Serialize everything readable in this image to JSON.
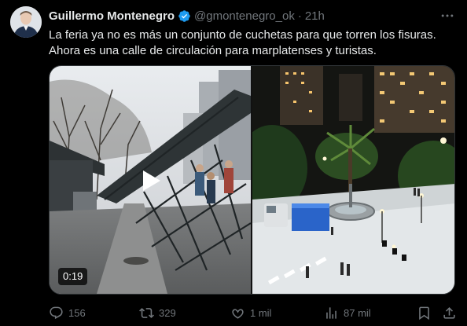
{
  "author": {
    "name": "Guillermo Montenegro",
    "handle": "@gmontenegro_ok",
    "separator": "·",
    "time": "21h",
    "verified": true
  },
  "tweet": {
    "line1": "La feria ya no es más un conjunto de cuchetas para que torren los fisuras.",
    "line2": "Ahora es una calle de circulación para marplatenses y turistas."
  },
  "media": {
    "video_duration": "0:19",
    "left_image": "video-thumbnail-dismantling-stalls",
    "right_image": "night-aerial-plaza-fountain"
  },
  "actions": {
    "replies": "156",
    "reposts": "329",
    "likes": "1 mil",
    "views": "87 mil"
  },
  "colors": {
    "background": "#000000",
    "text": "#e7e9ea",
    "muted": "#71767b",
    "verified": "#1d9bf0",
    "border": "#2f3336"
  },
  "icons": [
    "verified-badge-icon",
    "more-icon",
    "play-icon",
    "reply-icon",
    "repost-icon",
    "like-icon",
    "views-icon",
    "bookmark-icon",
    "share-icon"
  ]
}
